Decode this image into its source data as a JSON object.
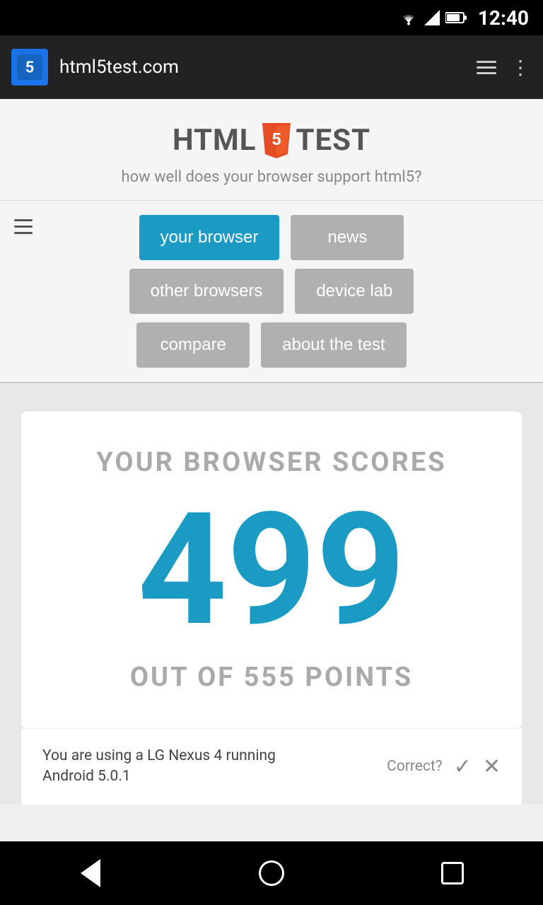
{
  "status_bar": {
    "time": "12:40"
  },
  "browser_toolbar": {
    "favicon_label": "5",
    "url": "html5test.com",
    "hamburger_aria": "menu",
    "more_aria": "more options"
  },
  "site_header": {
    "logo_html": "HTML",
    "logo_number": "5",
    "logo_test": "TEST",
    "tagline": "how well does your browser support html5?"
  },
  "nav_buttons": {
    "row1": [
      {
        "label": "your browser",
        "state": "active"
      },
      {
        "label": "news",
        "state": "inactive"
      }
    ],
    "row2": [
      {
        "label": "other browsers",
        "state": "inactive"
      },
      {
        "label": "device lab",
        "state": "inactive"
      }
    ],
    "row3": [
      {
        "label": "compare",
        "state": "inactive"
      },
      {
        "label": "about the test",
        "state": "inactive"
      }
    ]
  },
  "score_card": {
    "label": "Your Browser Scores",
    "score": "499",
    "total_label": "Out of 555 Points"
  },
  "device_info": {
    "text_line1": "You are using a LG Nexus 4 running",
    "text_line2": "Android 5.0.1",
    "correct_label": "Correct?"
  },
  "bottom_nav": {
    "back_aria": "back",
    "home_aria": "home",
    "recents_aria": "recents"
  }
}
